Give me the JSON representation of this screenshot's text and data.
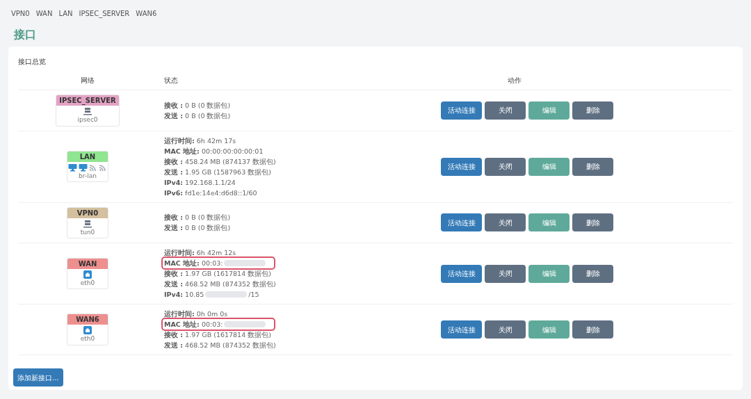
{
  "tabs": [
    {
      "label": "VPN0"
    },
    {
      "label": "WAN"
    },
    {
      "label": "LAN"
    },
    {
      "label": "IPSEC_SERVER"
    },
    {
      "label": "WAN6"
    }
  ],
  "title": "接口",
  "section_title": "接口总览",
  "columns": [
    "网络",
    "状态",
    "动作"
  ],
  "rows": [
    {
      "name": "IPSEC_SERVER",
      "color": "#e3a3c4",
      "device": "ipsec0",
      "icons": [
        {
          "kind": "server"
        }
      ],
      "lines": [
        {
          "label": "接收 :",
          "value": "0 B (0 数据包)"
        },
        {
          "label": "发送 :",
          "value": "0 B (0 数据包)"
        }
      ],
      "actions": [
        {
          "label": "活动连接",
          "kind": "primary"
        },
        {
          "label": "关闭",
          "kind": "neutral"
        },
        {
          "label": "编辑",
          "kind": "edit"
        },
        {
          "label": "删除",
          "kind": "neutral"
        }
      ]
    },
    {
      "name": "LAN",
      "color": "#90e590",
      "device": "br-lan",
      "icons": [
        {
          "kind": "monitor"
        },
        {
          "kind": "monitor"
        },
        {
          "kind": "wifi"
        },
        {
          "kind": "wifi"
        }
      ],
      "lines": [
        {
          "label": "运行时间:",
          "value": "6h 42m 17s"
        },
        {
          "label": "MAC 地址:",
          "value": "00:00:00:00:00:01"
        },
        {
          "label": "接收 :",
          "value": "458.24 MB (874137 数据包)"
        },
        {
          "label": "发送 :",
          "value": "1.95 GB (1587963 数据包)"
        },
        {
          "label": "IPv4:",
          "value": "192.168.1.1/24"
        },
        {
          "label": "IPv6:",
          "value": "fd1e:14e4:d6d8::1/60"
        }
      ],
      "actions": [
        {
          "label": "活动连接",
          "kind": "primary"
        },
        {
          "label": "关闭",
          "kind": "neutral"
        },
        {
          "label": "编辑",
          "kind": "edit"
        },
        {
          "label": "删除",
          "kind": "neutral"
        }
      ]
    },
    {
      "name": "VPN0",
      "color": "#d4bf9e",
      "device": "tun0",
      "icons": [
        {
          "kind": "server"
        }
      ],
      "lines": [
        {
          "label": "接收 :",
          "value": "0 B (0 数据包)"
        },
        {
          "label": "发送 :",
          "value": "0 B (0 数据包)"
        }
      ],
      "actions": [
        {
          "label": "活动连接",
          "kind": "primary"
        },
        {
          "label": "关闭",
          "kind": "neutral"
        },
        {
          "label": "编辑",
          "kind": "edit"
        },
        {
          "label": "删除",
          "kind": "neutral"
        }
      ]
    },
    {
      "name": "WAN",
      "color": "#ee8f8f",
      "device": "eth0",
      "icons": [
        {
          "kind": "port"
        }
      ],
      "lines": [
        {
          "label": "运行时间:",
          "value": "6h 42m 12s"
        },
        {
          "label": "MAC 地址:",
          "value": "00:03:",
          "redacted": true,
          "highlighted": true
        },
        {
          "label": "接收 :",
          "value": "1.97 GB (1617814 数据包)"
        },
        {
          "label": "发送 :",
          "value": "468.52 MB (874352 数据包)"
        },
        {
          "label": "IPv4:",
          "value": "10.85",
          "redacted": true,
          "suffix": "/15"
        }
      ],
      "actions": [
        {
          "label": "活动连接",
          "kind": "primary"
        },
        {
          "label": "关闭",
          "kind": "neutral"
        },
        {
          "label": "编辑",
          "kind": "edit"
        },
        {
          "label": "删除",
          "kind": "neutral"
        }
      ]
    },
    {
      "name": "WAN6",
      "color": "#ee8f8f",
      "device": "eth0",
      "icons": [
        {
          "kind": "port"
        }
      ],
      "lines": [
        {
          "label": "运行时间:",
          "value": "0h 0m 0s"
        },
        {
          "label": "MAC 地址:",
          "value": "00:03:",
          "redacted": true,
          "highlighted": true
        },
        {
          "label": "接收 :",
          "value": "1.97 GB (1617814 数据包)"
        },
        {
          "label": "发送 :",
          "value": "468.52 MB (874352 数据包)"
        }
      ],
      "actions": [
        {
          "label": "活动连接",
          "kind": "primary"
        },
        {
          "label": "关闭",
          "kind": "neutral"
        },
        {
          "label": "编辑",
          "kind": "edit"
        },
        {
          "label": "删除",
          "kind": "neutral"
        }
      ]
    }
  ],
  "add_button": "添加新接口..."
}
